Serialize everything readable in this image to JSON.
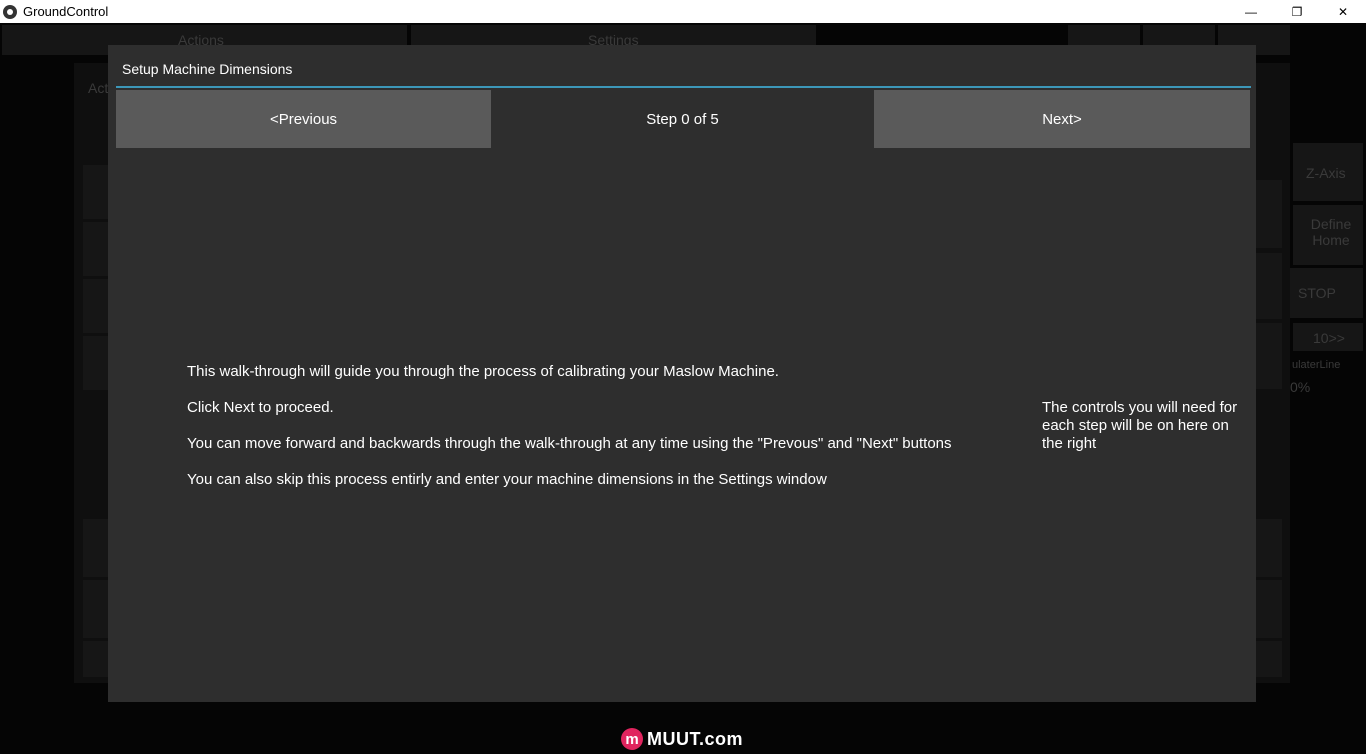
{
  "window": {
    "title": "GroundControl",
    "minimize_glyph": "—",
    "restore_glyph": "❐",
    "close_glyph": "✕"
  },
  "background": {
    "tab_actions": "Actions",
    "tab_settings": "Settings",
    "sub_tab": "Acti",
    "btn_z_axis": "Z-Axis",
    "btn_define_home": "Define Home",
    "btn_stop": "STOP",
    "btn_ten": "10>>",
    "label_side": "ulaterLine",
    "label_pct": "0%"
  },
  "modal": {
    "title": "Setup Machine Dimensions",
    "previous_label": "<Previous",
    "step_label": "Step 0 of 5",
    "next_label": "Next>",
    "instructions": [
      "This walk-through will guide you through the process of calibrating your Maslow Machine.",
      "Click Next to proceed.",
      "You can move forward and backwards through the walk-through at any time using the \"Prevous\" and \"Next\" buttons",
      "You can also skip this process entirly and enter your machine dimensions in the Settings window"
    ],
    "right_note": "The controls you will need for each step will be on here on the right"
  },
  "watermark": {
    "logo_letter": "m",
    "text": "MUUT.com"
  },
  "colors": {
    "modal_bg": "#2e2e2e",
    "button_bg": "#5a5a5a",
    "separator": "#3c97b8",
    "watermark_accent": "#e0245e"
  }
}
